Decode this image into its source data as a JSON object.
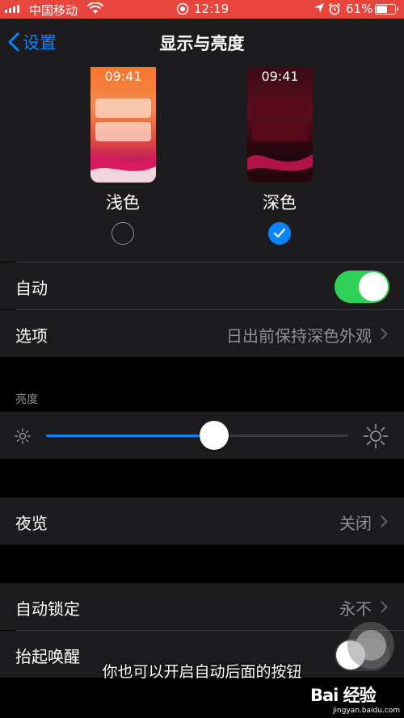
{
  "status_bar": {
    "carrier": "中国移动",
    "time": "12:19",
    "battery": "61%",
    "battery_level": 0.61,
    "background_color": "#e8453c"
  },
  "nav": {
    "back_label": "设置",
    "title": "显示与亮度",
    "accent_color": "#0a84ff"
  },
  "appearance": {
    "preview_time": "09:41",
    "light_label": "浅色",
    "dark_label": "深色",
    "selected": "dark"
  },
  "settings": {
    "automatic_label": "自动",
    "automatic_on": true,
    "options_label": "选项",
    "options_value": "日出前保持深色外观"
  },
  "brightness": {
    "header": "亮度",
    "level": 0.555
  },
  "night_shift": {
    "label": "夜览",
    "value": "关闭"
  },
  "lock": {
    "auto_lock_label": "自动锁定",
    "auto_lock_value": "永不",
    "raise_to_wake_label": "抬起唤醒",
    "raise_to_wake_on": false
  },
  "overlay": {
    "caption": "你也可以开启自动后面的按钮",
    "watermark_brand": "Bai 经验",
    "watermark_url": "jingyan.baidu.com"
  }
}
